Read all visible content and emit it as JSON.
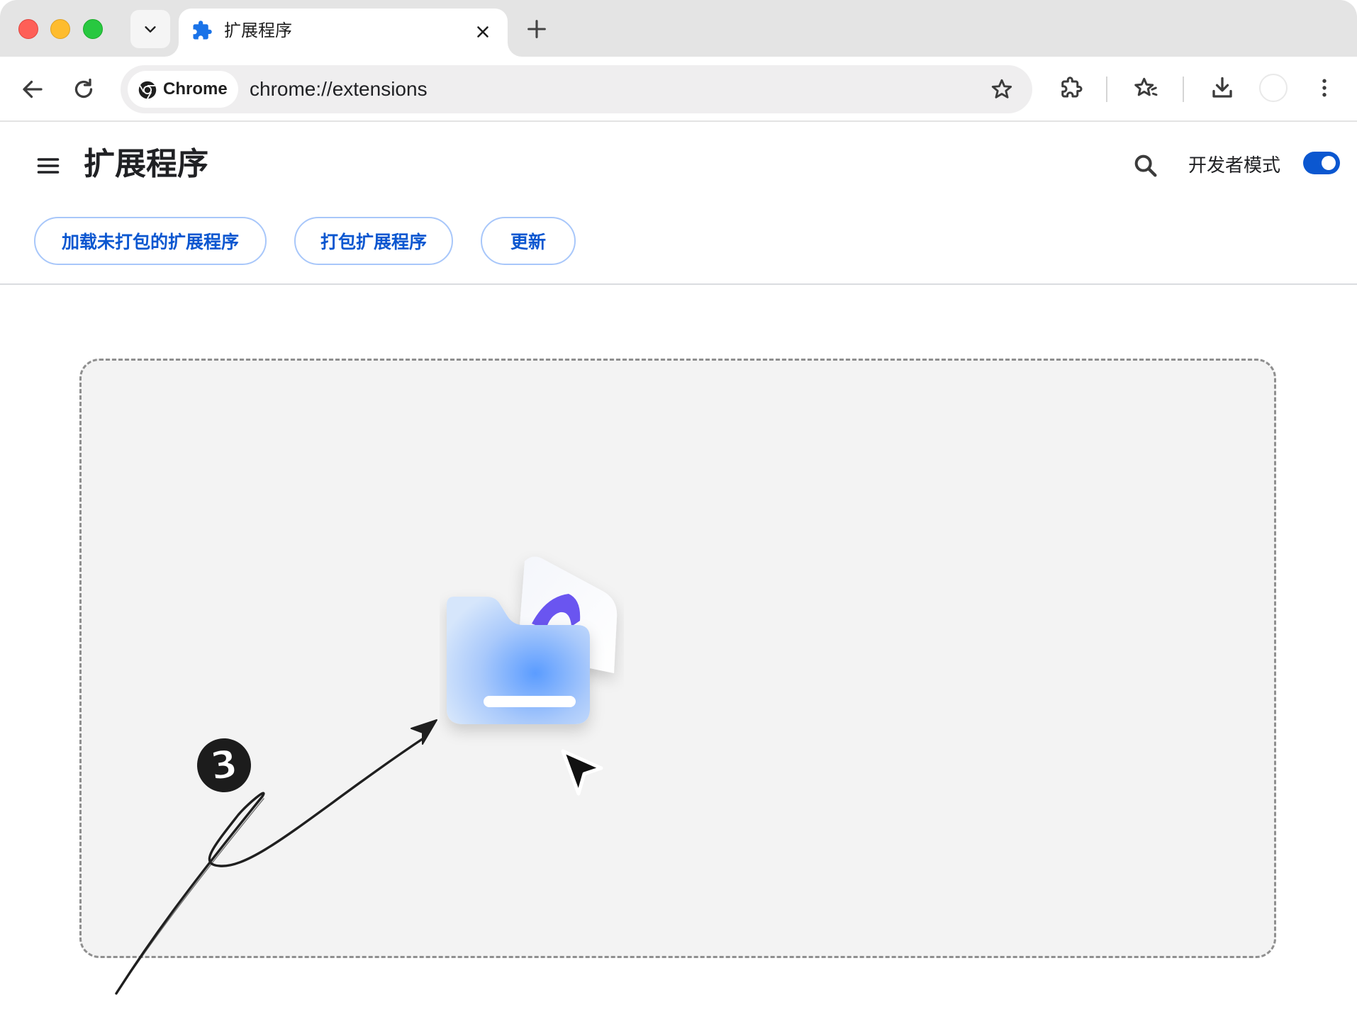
{
  "tab": {
    "title": "扩展程序",
    "close_icon": "close-icon",
    "favicon": "puzzle-icon"
  },
  "toolbar": {
    "chip_label": "Chrome",
    "url": "chrome://extensions"
  },
  "header": {
    "title": "扩展程序",
    "developer_mode_label": "开发者模式",
    "developer_mode_on": true
  },
  "actions": {
    "load_unpacked": "加载未打包的扩展程序",
    "pack_extension": "打包扩展程序",
    "update": "更新"
  },
  "annotation": {
    "step_number": "3"
  },
  "colors": {
    "accent": "#0b57d0",
    "button_border": "#a8c7fa",
    "dropzone_bg": "#f3f3f3"
  }
}
